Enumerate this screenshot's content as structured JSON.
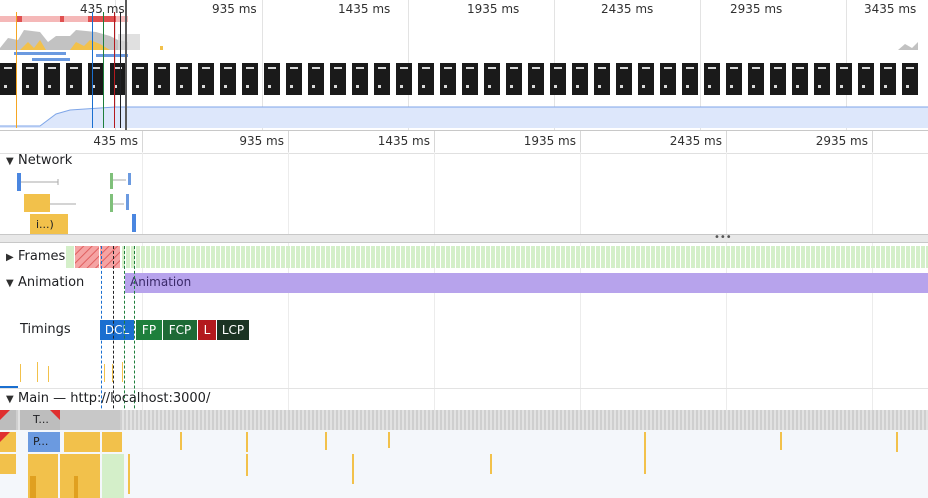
{
  "overview": {
    "ticks": [
      "435 ms",
      "935 ms",
      "1435 ms",
      "1935 ms",
      "2435 ms",
      "2935 ms",
      "3435 ms"
    ]
  },
  "ruler": {
    "ticks": [
      "435 ms",
      "935 ms",
      "1435 ms",
      "1935 ms",
      "2435 ms",
      "2935 ms"
    ]
  },
  "tracks": {
    "network": {
      "label": "Network",
      "request_label": "i...)"
    },
    "frames": {
      "label": "Frames"
    },
    "animation": {
      "label": "Animation",
      "bar_label": "Animation"
    },
    "timings": {
      "label": "Timings",
      "markers": [
        {
          "label": "DCL",
          "color": "#1a6fd0"
        },
        {
          "label": "FP",
          "color": "#1e7f3c"
        },
        {
          "label": "FCP",
          "color": "#1e6a36"
        },
        {
          "label": "L",
          "color": "#b3191e"
        },
        {
          "label": "LCP",
          "color": "#1b3323"
        }
      ]
    },
    "main": {
      "label": "Main — http://localhost:3000/",
      "task_label": "T...",
      "parse_label": "P..."
    }
  },
  "colors": {
    "scripting": "#f2c14b",
    "rendering": "#a78be0",
    "painting": "#7fc07a",
    "loading": "#6b9ae0",
    "frames_dropped": "#f5a3a3",
    "frames_ok": "#d4efc9",
    "memory": "#dde7fb"
  }
}
